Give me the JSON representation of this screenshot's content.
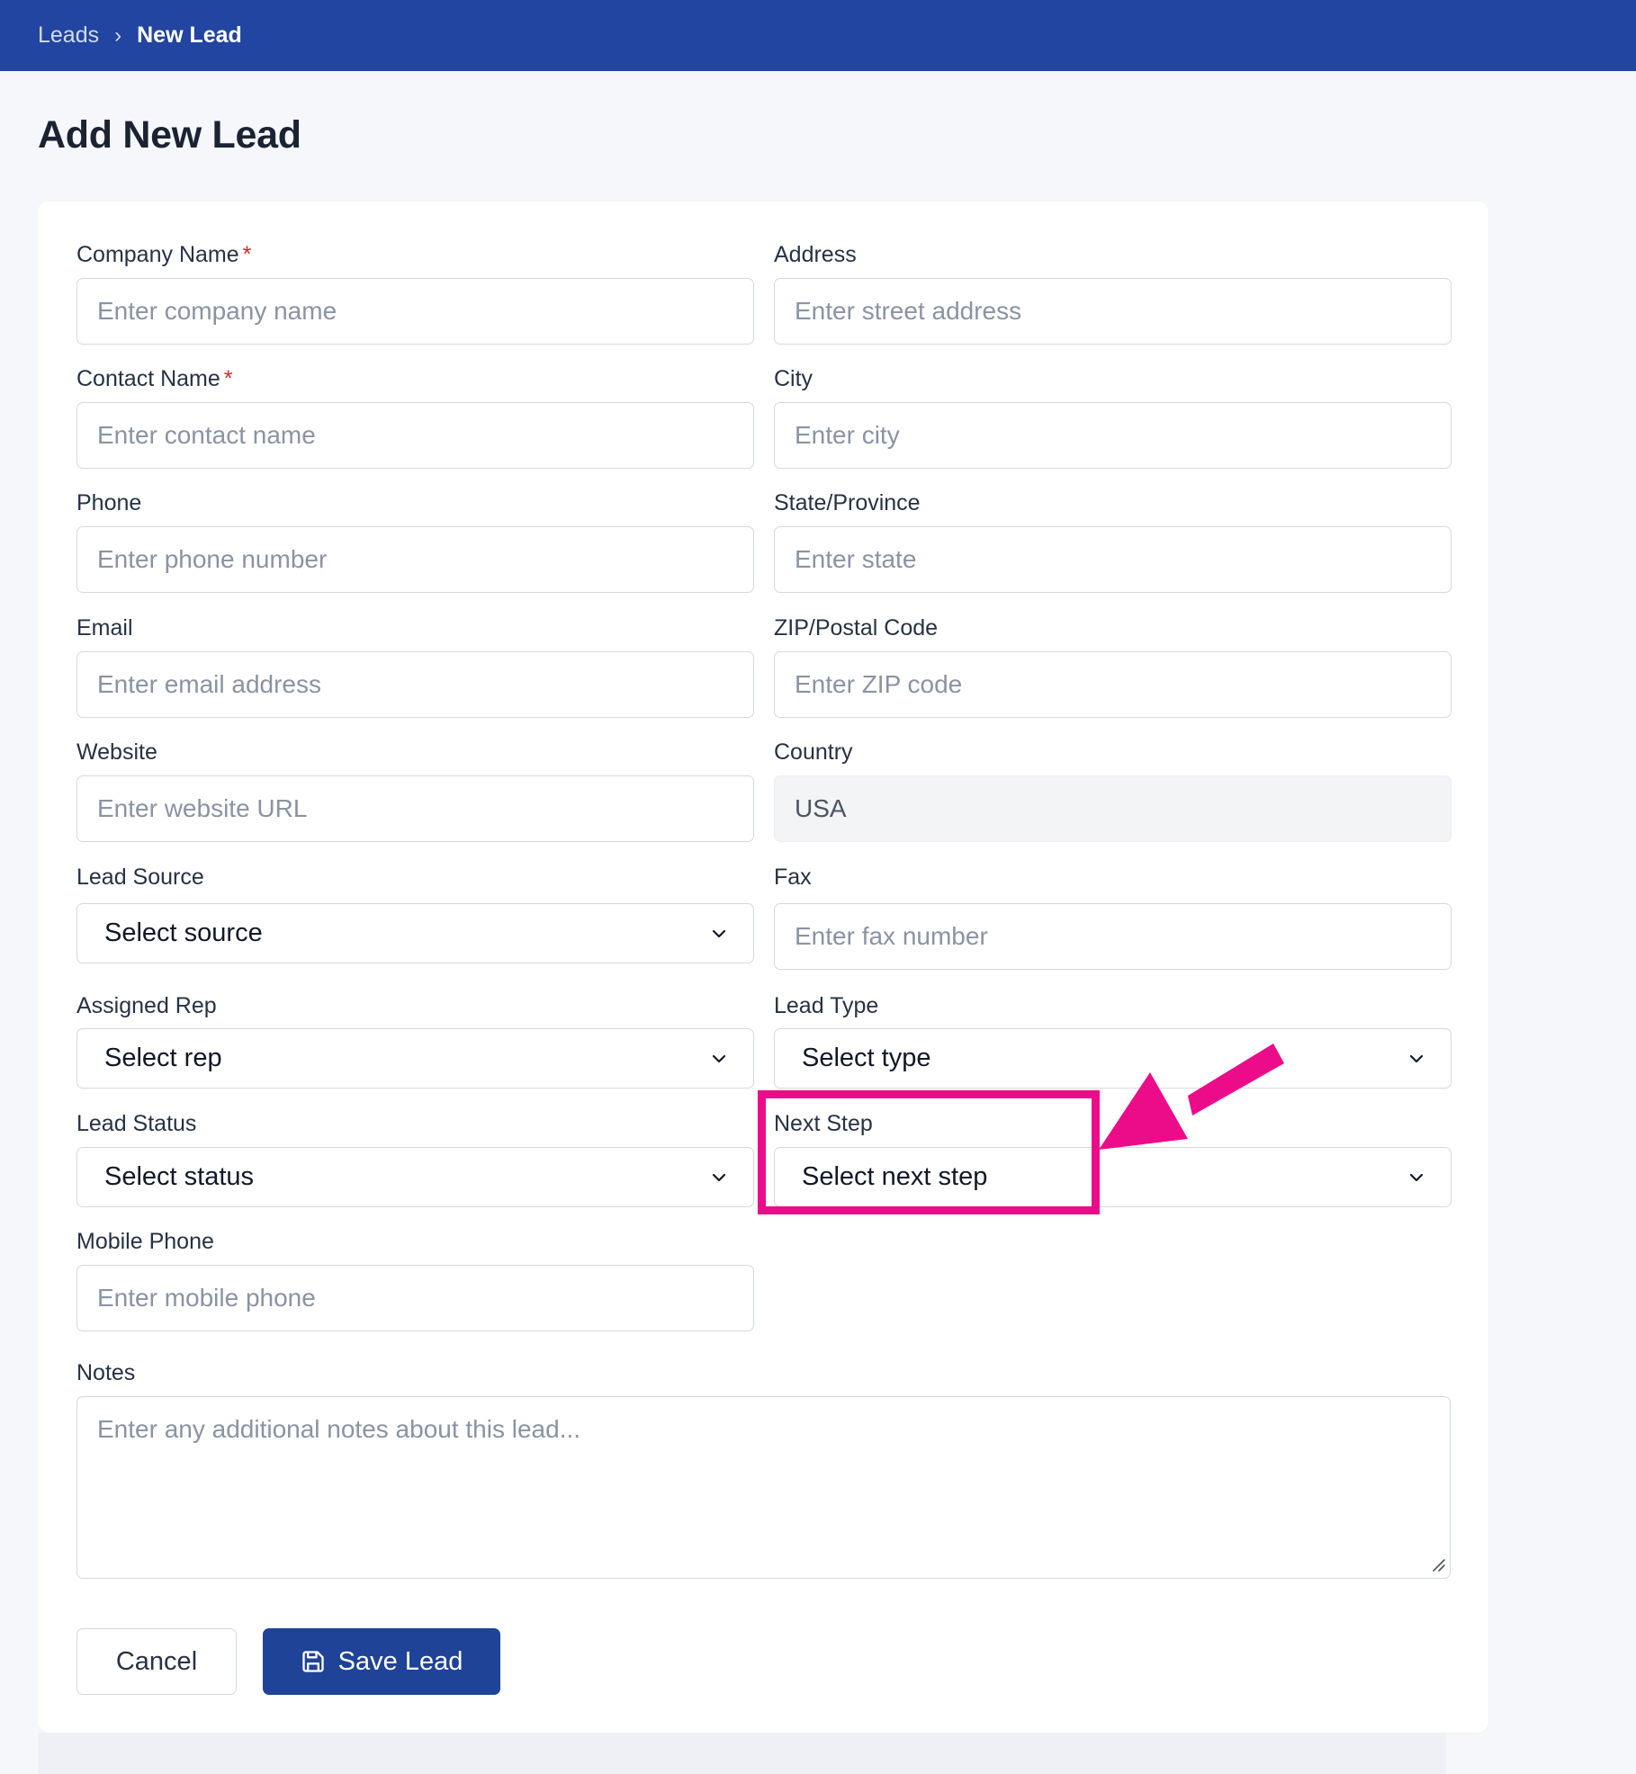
{
  "breadcrumb": {
    "parent": "Leads",
    "separator": "›",
    "current": "New Lead"
  },
  "page": {
    "title": "Add New Lead"
  },
  "form": {
    "company_name": {
      "label": "Company Name",
      "required_mark": "*",
      "placeholder": "Enter company name"
    },
    "contact_name": {
      "label": "Contact Name",
      "required_mark": "*",
      "placeholder": "Enter contact name"
    },
    "phone": {
      "label": "Phone",
      "placeholder": "Enter phone number"
    },
    "email": {
      "label": "Email",
      "placeholder": "Enter email address"
    },
    "website": {
      "label": "Website",
      "placeholder": "Enter website URL"
    },
    "lead_source": {
      "label": "Lead Source",
      "selected": "Select source"
    },
    "assigned_rep": {
      "label": "Assigned Rep",
      "selected": "Select rep"
    },
    "lead_status": {
      "label": "Lead Status",
      "selected": "Select status"
    },
    "mobile_phone": {
      "label": "Mobile Phone",
      "placeholder": "Enter mobile phone"
    },
    "address": {
      "label": "Address",
      "placeholder": "Enter street address"
    },
    "city": {
      "label": "City",
      "placeholder": "Enter city"
    },
    "state": {
      "label": "State/Province",
      "placeholder": "Enter state"
    },
    "zip": {
      "label": "ZIP/Postal Code",
      "placeholder": "Enter ZIP code"
    },
    "country": {
      "label": "Country",
      "value": "USA"
    },
    "fax": {
      "label": "Fax",
      "placeholder": "Enter fax number"
    },
    "lead_type": {
      "label": "Lead Type",
      "selected": "Select type"
    },
    "next_step": {
      "label": "Next Step",
      "selected": "Select next step"
    },
    "notes": {
      "label": "Notes",
      "placeholder": "Enter any additional notes about this lead..."
    }
  },
  "actions": {
    "cancel_label": "Cancel",
    "save_label": "Save Lead"
  },
  "colors": {
    "header": "#2145a0",
    "primary_button": "#1f4396",
    "required": "#dc2626",
    "annotation": "#ec0c8a"
  },
  "icons": {
    "select_caret": "chevron-down-icon",
    "save": "save-icon",
    "resize": "resize-grip-icon"
  }
}
